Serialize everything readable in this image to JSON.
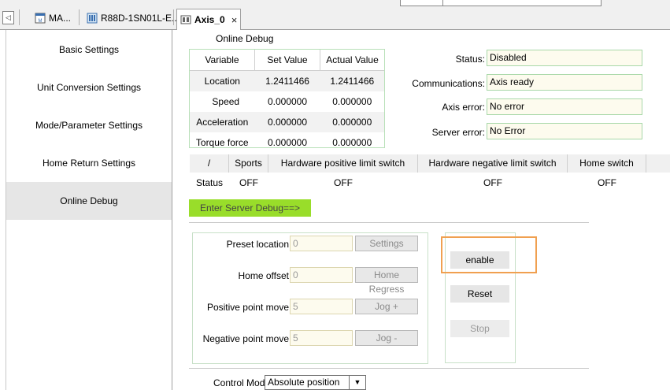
{
  "tabs": [
    {
      "label": "MA...",
      "icon": "motion-app-icon",
      "closable": false
    },
    {
      "label": "R88D-1SN01L-E...",
      "icon": "servo-drive-icon",
      "closable": false
    },
    {
      "label": "Axis_0",
      "icon": "axis-icon",
      "closable": true,
      "active": true
    }
  ],
  "tab_close_glyph": "×",
  "sidebar": {
    "items": [
      {
        "label": "Basic Settings"
      },
      {
        "label": "Unit Conversion Settings"
      },
      {
        "label": "Mode/Parameter Settings"
      },
      {
        "label": "Home Return Settings"
      },
      {
        "label": "Online Debug",
        "selected": true
      }
    ]
  },
  "online_debug": {
    "title": "Online Debug",
    "table": {
      "headers": [
        "Variable",
        "Set Value",
        "Actual Value"
      ],
      "rows": [
        [
          "Location",
          "1.2411466",
          "1.2411466"
        ],
        [
          "Speed",
          "0.000000",
          "0.000000"
        ],
        [
          "Acceleration",
          "0.000000",
          "0.000000"
        ],
        [
          "Torque force",
          "0.000000",
          "0.000000"
        ]
      ]
    },
    "status_fields": [
      {
        "label": "Status:",
        "value": "Disabled"
      },
      {
        "label": "Communications:",
        "value": "Axis ready"
      },
      {
        "label": "Axis error:",
        "value": "No error"
      },
      {
        "label": "Server error:",
        "value": "No Error"
      }
    ],
    "status_grid": {
      "headers": [
        "/",
        "Sports",
        "Hardware positive limit switch",
        "Hardware negative limit switch",
        "Home switch"
      ],
      "row": [
        "Status",
        "OFF",
        "OFF",
        "OFF",
        "OFF"
      ]
    },
    "enter_button": "Enter Server Debug==>",
    "params": [
      {
        "label": "Preset location",
        "value": "0",
        "button": "Settings"
      },
      {
        "label": "Home offset",
        "value": "0",
        "button": "Home Regress"
      },
      {
        "label": "Positive point move",
        "value": "5",
        "button": "Jog +"
      },
      {
        "label": "Negative point move",
        "value": "5",
        "button": "Jog -"
      }
    ],
    "controls": {
      "enable": "enable",
      "reset": "Reset",
      "stop": "Stop"
    },
    "control_mode": {
      "label": "Control Mode",
      "value": "Absolute position"
    }
  },
  "colors": {
    "accent_green": "#99dd2a",
    "highlight_orange": "#f0a050",
    "field_bg": "#fdfbee"
  }
}
